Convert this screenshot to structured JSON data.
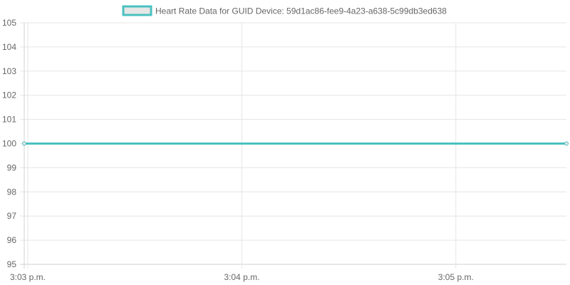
{
  "chart_data": {
    "type": "line",
    "title": "",
    "xlabel": "",
    "ylabel": "",
    "x_tick_labels": [
      "3:03 p.m.",
      "3:04 p.m.",
      "3:05 p.m."
    ],
    "x_tick_values": [
      "15:03",
      "15:04",
      "15:05"
    ],
    "x_range": [
      "15:02:59",
      "15:05:31"
    ],
    "ylim": [
      95,
      105
    ],
    "y_ticks": [
      95,
      96,
      97,
      98,
      99,
      100,
      101,
      102,
      103,
      104,
      105
    ],
    "grid": true,
    "legend_position": "top",
    "series": [
      {
        "name": "Heart Rate Data for GUID Device: 59d1ac86-fee9-4a23-a638-5c99db3ed638",
        "color": "#4bc0c0",
        "fill_color": "#e6e6e6",
        "x": [
          "15:02:59",
          "15:05:31"
        ],
        "values": [
          100,
          100
        ]
      }
    ]
  }
}
